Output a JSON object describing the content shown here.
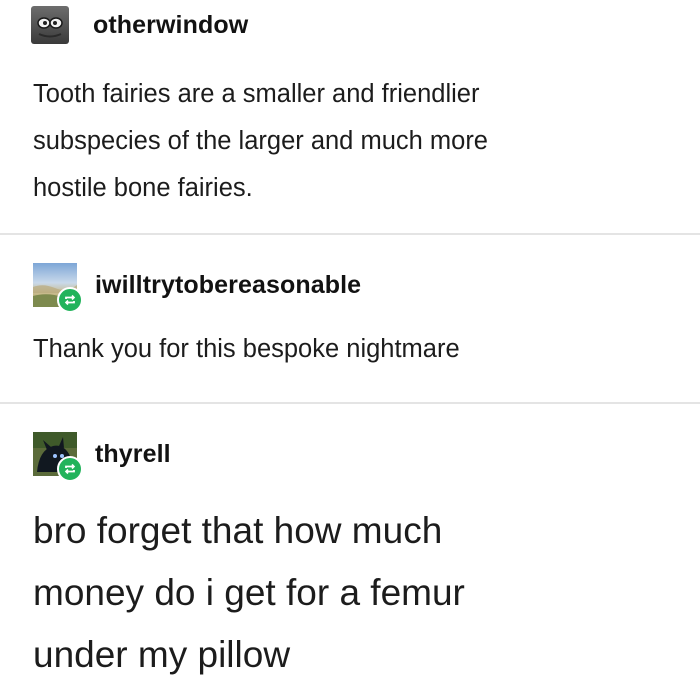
{
  "posts": [
    {
      "username": "otherwindow",
      "avatar_icon": "goggle-eyes-avatar-icon",
      "text": "Tooth fairies are a smaller and friendlier\nsubspecies of the larger and much more\nhostile bone fairies."
    },
    {
      "username": "iwilltrytobereasonable",
      "avatar_icon": "landscape-avatar-icon",
      "badge_icon": "reblog-icon",
      "text": "Thank you for this bespoke nightmare"
    },
    {
      "username": "thyrell",
      "avatar_icon": "dark-creature-avatar-icon",
      "badge_icon": "reblog-icon",
      "text": "bro forget that how much\nmoney do i get for a femur\nunder my pillow"
    }
  ],
  "colors": {
    "badge": "#22b35b",
    "divider": "#e4e4e4",
    "text": "#1c1c1c"
  }
}
